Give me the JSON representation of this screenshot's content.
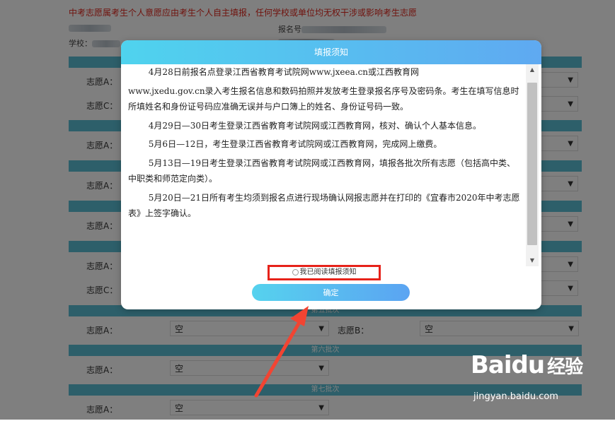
{
  "page": {
    "notice": "中考志愿属考生个人意愿应由考生个人自主填报，任何学校或单位均无权干涉或影响考生志愿",
    "school_label": "学校：",
    "reg_label": "报名号",
    "rows": [
      {
        "label_a": "志愿A：",
        "label_c": "志愿C："
      },
      {
        "label_a": "志愿A："
      },
      {
        "label_a": "志愿A："
      },
      {
        "label_a": "志愿A："
      },
      {
        "label_a": "志愿A：",
        "label_c": "志愿C："
      }
    ],
    "batch5_label": "第五批次",
    "batch6_label": "第六批次",
    "batch7_label": "第七批次",
    "wish_a": "志愿A：",
    "wish_b": "志愿B：",
    "empty_option": "空"
  },
  "modal": {
    "title": "填报须知",
    "paragraphs": [
      "4月28日前报名点登录江西省教育考试院网www.jxeea.cn或江西教育网",
      "www.jxedu.gov.cn录入考生报名信息和数码拍照并发放考生登录报名序号及密码条。考生在填写信息时所填姓名和身份证号码应准确无误并与户口簿上的姓名、身份证号码一致。",
      "4月29日—30日考生登录江西省教育考试院网或江西教育网，核对、确认个人基本信息。",
      "5月6日—12日，考生登录江西省教育考试院网或江西教育网，完成网上缴费。",
      "5月13日—19日考生登录江西省教育考试院网或江西教育网，填报各批次所有志愿（包括高中类、中职类和师范定向类）。",
      "5月20日—21日所有考生均须到报名点进行现场确认网报志愿并在打印的《宜春市2020年中考志愿表》上签字确认。"
    ],
    "agree_label": "我已阅读填报须知",
    "confirm_label": "确定"
  },
  "watermark": {
    "logo": "Baidu",
    "logo_cn": "经验",
    "url": "jingyan.baidu.com"
  }
}
